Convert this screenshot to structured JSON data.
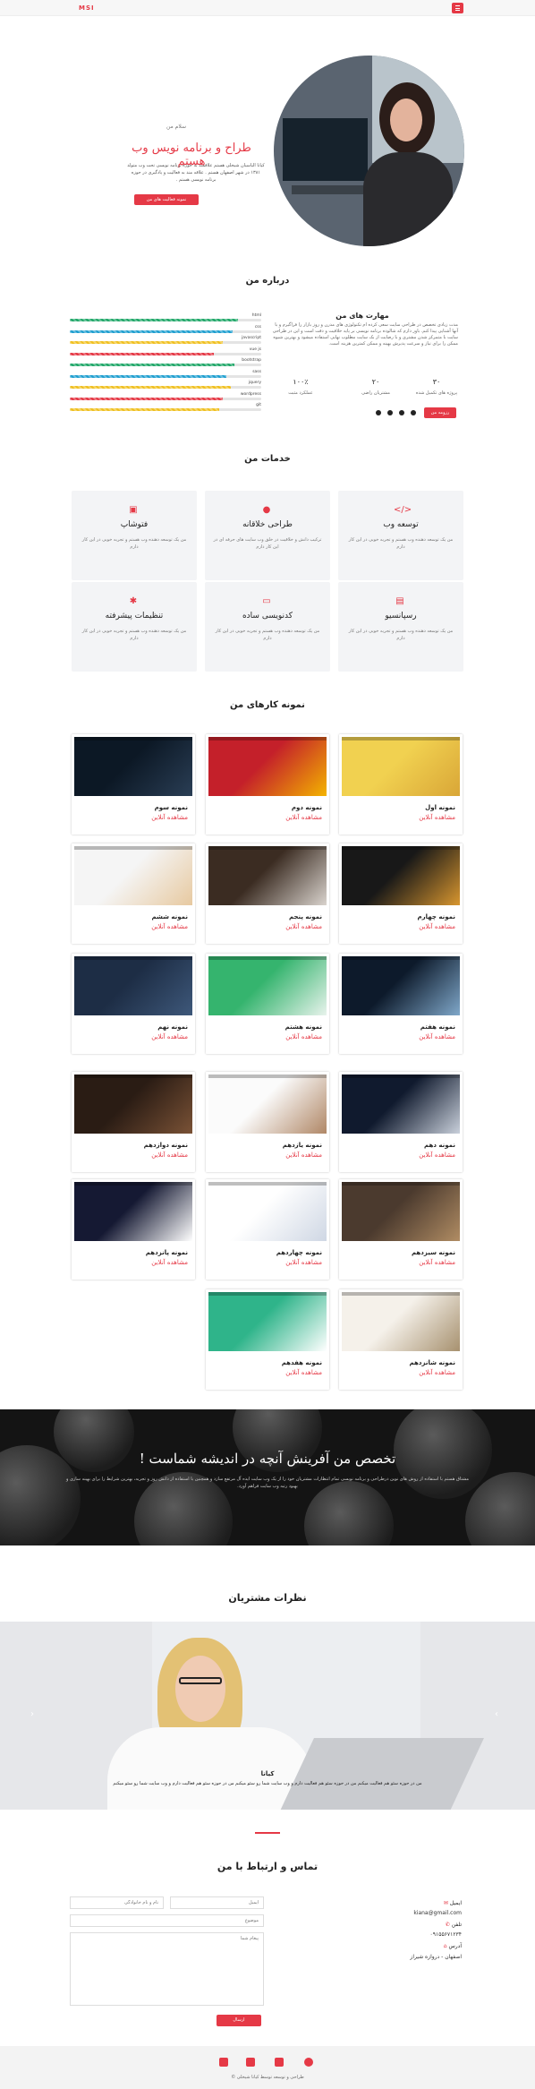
{
  "nav": {
    "logo": "MSI"
  },
  "hero": {
    "greeting": "سلام من",
    "title": "طراح و برنامه نویس وب هستم",
    "description": "کیانا الیاسیان شیخلی هستم علاقمند به حوزه برنامه نویسی تحت وب متولد ۱۳۸۱ در شهر اصفهان هستم . علاقه مند به فعالیت و یادگیری در حوزه برنامه نویسی هستم .",
    "button": "نمونه فعالیت های من"
  },
  "about": {
    "title": "درباره من",
    "skills_title": "مهارت های من",
    "text": "مدت زیادی تخصص در طراحی سایت سعی کرده ام تکنولوژی های مدرن و روز بازار را فراگیرم و با آنها آشنایی پیدا کنم. باور دارم که شالوده برنامه نویسی بر پایه خلاقیت و دقت است و این در طراحی سایت با متمرکز شدن مشتری و با رضایت از بک سایت مطلوب نهایی استفاده میشود و بهترین شیوه ممکن را برای نیاز و سرعت پذیرش بهینه و ممکن کمترین هزینه است.",
    "stats": [
      {
        "num": "۳۰",
        "label": "پروژه های تکمیل شده"
      },
      {
        "num": "۲۰",
        "label": "مشتریان راضی"
      },
      {
        "num": "۱۰۰٪",
        "label": "عملکرد مثبت"
      }
    ],
    "button": "رزومه من",
    "skills": [
      {
        "label": "html",
        "pct": 0.88,
        "color": "#22a86a"
      },
      {
        "label": "css",
        "pct": 0.85,
        "color": "#1f9fd0"
      },
      {
        "label": "javascript",
        "pct": 0.8,
        "color": "#f0c020"
      },
      {
        "label": "vue js",
        "pct": 0.75,
        "color": "#e53946"
      },
      {
        "label": "bootstrap",
        "pct": 0.86,
        "color": "#22a86a"
      },
      {
        "label": "sass",
        "pct": 0.82,
        "color": "#1f9fd0"
      },
      {
        "label": "jquery",
        "pct": 0.84,
        "color": "#f0c020"
      },
      {
        "label": "wordpress",
        "pct": 0.8,
        "color": "#e53946"
      },
      {
        "label": "git",
        "pct": 0.78,
        "color": "#f0c020"
      }
    ]
  },
  "services": {
    "title": "خدمات من",
    "items": [
      {
        "icon": "</>",
        "icon_name": "code-icon",
        "title": "توسعه وب",
        "desc": "من یک توسعه دهنده وب هستم و تجربه خوبی در این کار دارم"
      },
      {
        "icon": "●",
        "icon_name": "bulb-icon",
        "title": "طراحی خلاقانه",
        "desc": "ترکیب دانش و خلاقیت در خلق وب سایت های حرفه ای در این کار دارم"
      },
      {
        "icon": "▣",
        "icon_name": "image-icon",
        "title": "فتوشاپ",
        "desc": "من یک توسعه دهنده وب هستم و تجربه خوبی در این کار دارم"
      },
      {
        "icon": "▤",
        "icon_name": "mobile-icon",
        "title": "رسپانسیو",
        "desc": "من یک توسعه دهنده وب هستم و تجربه خوبی در این کار دارم"
      },
      {
        "icon": "▭",
        "icon_name": "monitor-icon",
        "title": "کدنویسی ساده",
        "desc": "من یک توسعه دهنده وب هستم و تجربه خوبی در این کار دارم"
      },
      {
        "icon": "✱",
        "icon_name": "settings-icon",
        "title": "تنظیمات پیشرفته",
        "desc": "من یک توسعه دهنده وب هستم و تجربه خوبی در این کار دارم"
      }
    ]
  },
  "portfolio": {
    "title": "نمونه کارهای من",
    "link_label": "مشاهده آنلاین",
    "items": [
      {
        "title": "نمونه اول",
        "palette": [
          "#f1d150",
          "#d9a637"
        ]
      },
      {
        "title": "نمونه دوم",
        "palette": [
          "#c4202a",
          "#f3b300"
        ]
      },
      {
        "title": "نمونه سوم",
        "palette": [
          "#0c1825",
          "#2a3e55"
        ]
      },
      {
        "title": "نمونه چهارم",
        "palette": [
          "#181818",
          "#d8962f"
        ]
      },
      {
        "title": "نمونه پنجم",
        "palette": [
          "#3b2c22",
          "#d9d3cd"
        ]
      },
      {
        "title": "نمونه ششم",
        "palette": [
          "#f5f5f5",
          "#e7c9a0"
        ]
      },
      {
        "title": "نمونه هفتم",
        "palette": [
          "#0d1a2b",
          "#7fa7c9"
        ]
      },
      {
        "title": "نمونه هشتم",
        "palette": [
          "#35b46e",
          "#e8f3ec"
        ]
      },
      {
        "title": "نمونه نهم",
        "palette": [
          "#1d2d45",
          "#3e587a"
        ]
      },
      {
        "title": "نمونه دهم",
        "palette": [
          "#101a2e",
          "#c9d0db"
        ]
      },
      {
        "title": "نمونه یازدهم",
        "palette": [
          "#fbfbfb",
          "#b08766"
        ]
      },
      {
        "title": "نمونه دوازدهم",
        "palette": [
          "#2a1c14",
          "#7a5236"
        ]
      },
      {
        "title": "نمونه سیزدهم",
        "palette": [
          "#4b3a2e",
          "#b08c63"
        ]
      },
      {
        "title": "نمونه چهاردهم",
        "palette": [
          "#ffffff",
          "#cfd7e4"
        ]
      },
      {
        "title": "نمونه پانزدهم",
        "palette": [
          "#151933",
          "#ffffff"
        ]
      },
      {
        "title": "نمونه شانزدهم",
        "palette": [
          "#f5f1ea",
          "#a7916f"
        ]
      },
      {
        "title": "نمونه هفدهم",
        "palette": [
          "#2fb48a",
          "#ffffff"
        ]
      }
    ]
  },
  "banner": {
    "title": "تخصص من آفرینش آنچه در اندیشه شماست !",
    "text": "مشتاق هستم با استفاده از روش های نوین درطراحی و برنامه نویسی تمام انتظارات مشتریان خود را از یک وب سایت ایده آل مرتفع سازد و همچنین با استفاده از دانش روز و تجربه، بهترین شرایط را برای بهینه سازی و بهبود رتبه وب سایت فراهم آورد."
  },
  "testimonials": {
    "title": "نظرات مشتریان",
    "name": "کیانا",
    "text": "من در حوزه سئو هم فعالیت میکنم من در حوزه سئو هم فعالیت دارم و وب سایت شما رو سئو میکنم من در حوزه سئو هم فعالیت دارم و وب سایت شما رو سئو میکنم"
  },
  "contact": {
    "title": "تماس و ارتباط با من",
    "name_placeholder": "نام و نام خانوادگی",
    "email_placeholder": "ایمیل",
    "subject_placeholder": "موضوع",
    "message_placeholder": "پیغام شما",
    "send": "ارسال",
    "email_label": "ایمیل",
    "email_value": "kiana@gmail.com",
    "phone_label": "تلفن",
    "phone_value": "۰۹۱۵۵۶۷۱۲۳۴",
    "address_label": "آدرس",
    "address_value": "اصفهان - دروازه شیراز"
  },
  "footer": {
    "text": "طراحی و توسعه توسط کیانا شیخلی ©"
  },
  "colors": {
    "accent": "#e53946"
  }
}
